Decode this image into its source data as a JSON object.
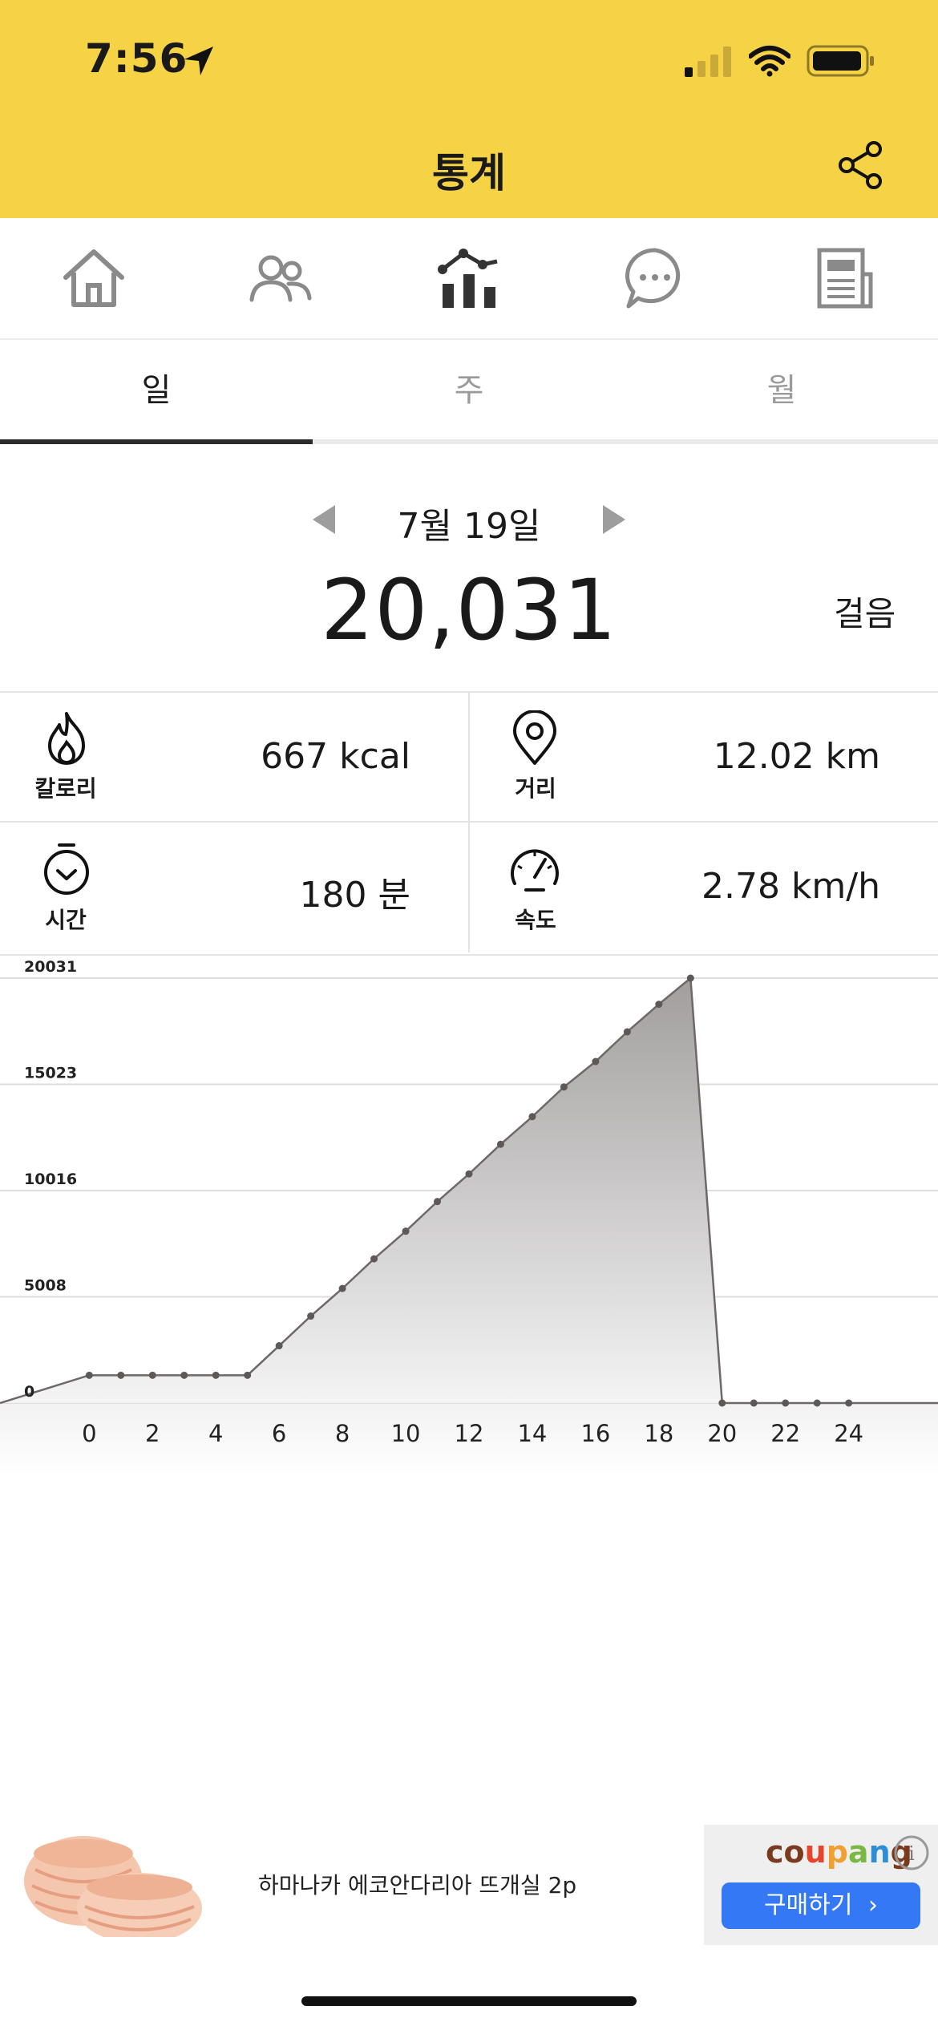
{
  "status_bar": {
    "time": "7:56"
  },
  "header": {
    "title": "통계"
  },
  "nav": {
    "icons": [
      "home-icon",
      "friends-icon",
      "stats-icon",
      "chat-icon",
      "news-icon"
    ],
    "active": "stats-icon"
  },
  "tabs": [
    {
      "label": "일",
      "active": true
    },
    {
      "label": "주",
      "active": false
    },
    {
      "label": "월",
      "active": false
    }
  ],
  "summary": {
    "date": "7월 19일",
    "steps": "20,031",
    "steps_unit": "걸음"
  },
  "stats": {
    "calories": {
      "label": "칼로리",
      "value": "667 kcal",
      "icon": "flame-icon"
    },
    "distance": {
      "label": "거리",
      "value": "12.02 km",
      "icon": "location-pin-icon"
    },
    "time": {
      "label": "시간",
      "value": "180 분",
      "icon": "stopwatch-icon"
    },
    "speed": {
      "label": "속도",
      "value": "2.78 km/h",
      "icon": "speedometer-icon"
    }
  },
  "chart_data": {
    "type": "area",
    "x": [
      0,
      1,
      2,
      3,
      4,
      5,
      6,
      7,
      8,
      9,
      10,
      11,
      12,
      13,
      14,
      15,
      16,
      17,
      18,
      19,
      20,
      21,
      22,
      23,
      24
    ],
    "y": [
      1310,
      1310,
      1310,
      1310,
      1310,
      1310,
      2700,
      4100,
      5400,
      6800,
      8100,
      9500,
      10800,
      12200,
      13500,
      14900,
      16100,
      17500,
      18800,
      20031,
      0,
      0,
      0,
      0,
      0
    ],
    "x_ticks": [
      0,
      2,
      4,
      6,
      8,
      10,
      12,
      14,
      16,
      18,
      20,
      22,
      24
    ],
    "y_ticks": [
      0,
      5008,
      10016,
      15023,
      20031
    ],
    "ylim": [
      0,
      20031
    ],
    "xlim": [
      -1.3,
      25.3
    ],
    "grid": true,
    "colors": {
      "line": "#6e6868",
      "fill_top": "#a29e9e",
      "fill_bottom": "#f4f4f4",
      "point": "#5e5858"
    }
  },
  "ad": {
    "text": "하마나카 에코안다리아 뜨개실 2p",
    "brand": "coupang",
    "brand_colors": [
      "#7a3a1e",
      "#7a3a1e",
      "#e8442c",
      "#f0a030",
      "#7ab743",
      "#2c8fd6",
      "#7a3a1e",
      "#7a3a1e"
    ],
    "button": "구매하기",
    "info": "i"
  }
}
